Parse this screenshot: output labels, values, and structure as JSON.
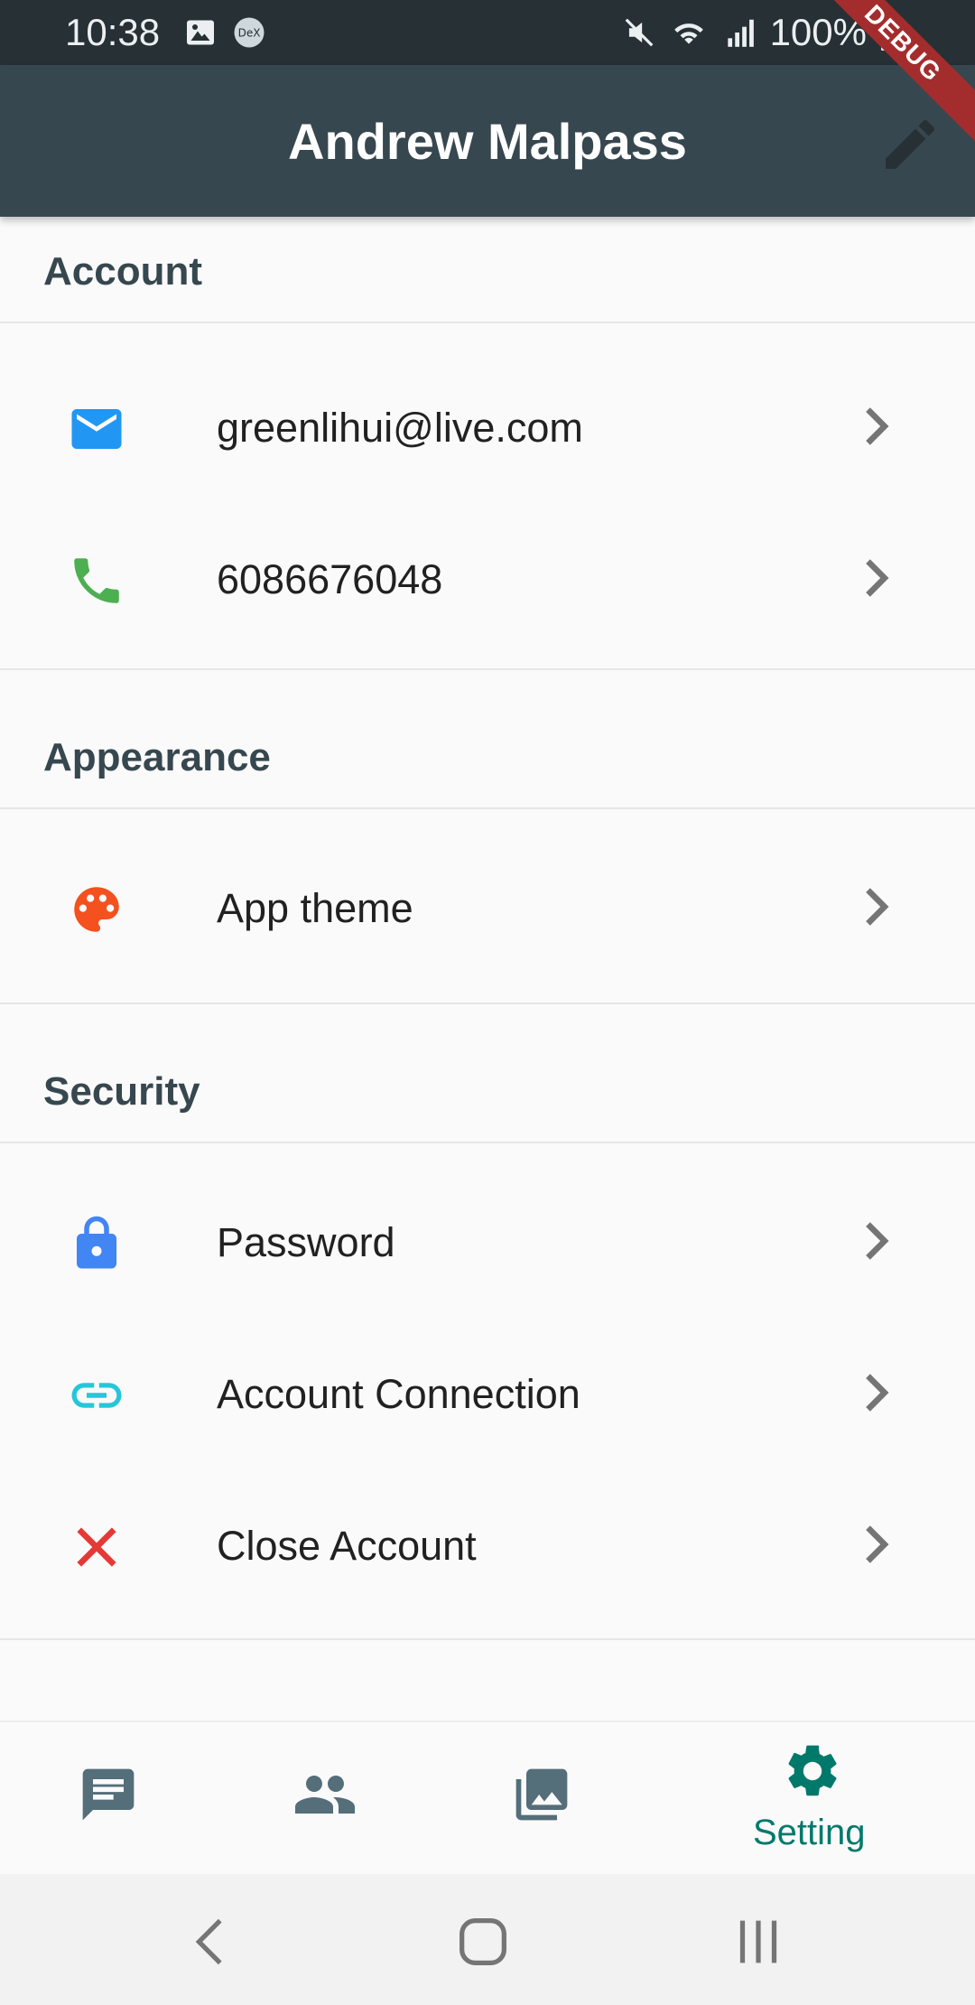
{
  "status_bar": {
    "time": "10:38",
    "battery_percent": "100%",
    "left_icons": [
      "image-icon",
      "dex-icon"
    ],
    "right_icons": [
      "mute-icon",
      "wifi-icon",
      "signal-icon",
      "battery-icon"
    ]
  },
  "app_bar": {
    "title": "Andrew Malpass",
    "edit_icon": "pencil-icon",
    "debug_banner": "DEBUG",
    "color": "#37474f"
  },
  "sections": {
    "account": {
      "header": "Account",
      "items": [
        {
          "icon": "mail-icon",
          "label": "greenlihui@live.com",
          "icon_color": "#2196f3"
        },
        {
          "icon": "phone-icon",
          "label": "6086676048",
          "icon_color": "#4caf50"
        }
      ]
    },
    "appearance": {
      "header": "Appearance",
      "items": [
        {
          "icon": "palette-icon",
          "label": "App theme",
          "icon_color": "#f4511e"
        }
      ]
    },
    "security": {
      "header": "Security",
      "items": [
        {
          "icon": "lock-icon",
          "label": "Password",
          "icon_color": "#4285f4"
        },
        {
          "icon": "link-icon",
          "label": "Account Connection",
          "icon_color": "#26c6da"
        },
        {
          "icon": "close-icon",
          "label": "Close Account",
          "icon_color": "#e53935"
        }
      ]
    }
  },
  "bottom_nav": {
    "items": [
      {
        "icon": "chat-icon",
        "label": ""
      },
      {
        "icon": "people-icon",
        "label": ""
      },
      {
        "icon": "photo-library-icon",
        "label": ""
      },
      {
        "icon": "settings-gear-icon",
        "label": "Setting",
        "selected": true
      }
    ],
    "selected_color": "#00796b",
    "unselected_color": "#546e7a"
  },
  "system_nav": {
    "icons": [
      "back-icon",
      "home-icon",
      "recents-icon"
    ]
  }
}
